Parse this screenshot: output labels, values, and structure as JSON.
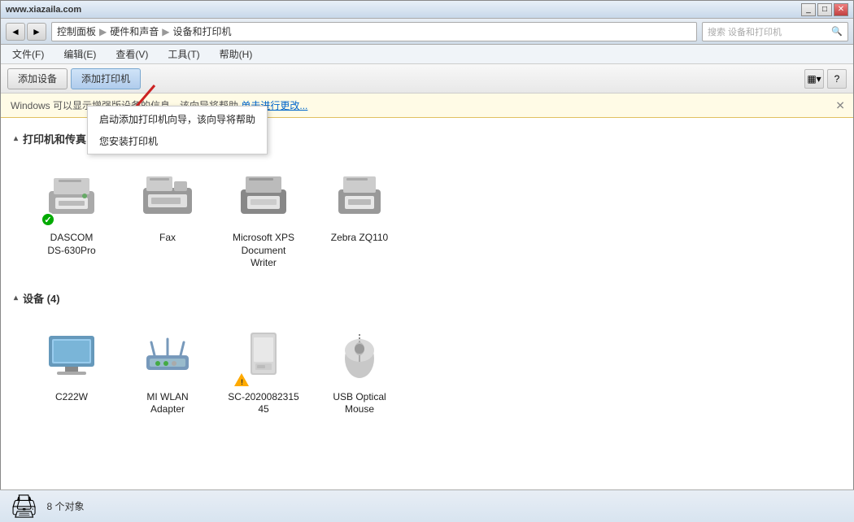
{
  "titleBar": {
    "logo": "www.xiazaila.com",
    "controls": [
      "_",
      "□",
      "✕"
    ]
  },
  "addressBar": {
    "navBack": "◄",
    "navForward": "►",
    "breadcrumb": [
      "控制面板",
      "硬件和声音",
      "设备和打印机"
    ],
    "searchPlaceholder": "搜索 设备和打印机"
  },
  "menuBar": {
    "items": [
      "文件(F)",
      "编辑(E)",
      "查看(V)",
      "工具(T)",
      "帮助(H)"
    ]
  },
  "toolbar": {
    "addDevice": "添加设备",
    "addPrinter": "添加打印机"
  },
  "notification": {
    "text": "Windows 可以显示增强版设备的信息，该向导将帮助",
    "link": "单击进行更改...",
    "dropdown": {
      "items": [
        "启动添加打印机向导，该向导将帮助",
        "您安装打印机"
      ]
    }
  },
  "sections": {
    "printers": {
      "title": "打印机和传真 (4)",
      "items": [
        {
          "name": "DASCOM\nDS-630Pro",
          "type": "printer",
          "status": "ok"
        },
        {
          "name": "Fax",
          "type": "fax",
          "status": ""
        },
        {
          "name": "Microsoft XPS\nDocument\nWriter",
          "type": "printer",
          "status": ""
        },
        {
          "name": "Zebra ZQ110",
          "type": "printer",
          "status": ""
        }
      ]
    },
    "devices": {
      "title": "设备 (4)",
      "items": [
        {
          "name": "C222W",
          "type": "monitor",
          "status": ""
        },
        {
          "name": "MI WLAN\nAdapter",
          "type": "router",
          "status": ""
        },
        {
          "name": "SC-2020082315\n45",
          "type": "storage",
          "status": "warn"
        },
        {
          "name": "USB Optical\nMouse",
          "type": "mouse",
          "status": ""
        }
      ]
    }
  },
  "statusBar": {
    "icon": "🖨",
    "text": "8 个对象"
  }
}
